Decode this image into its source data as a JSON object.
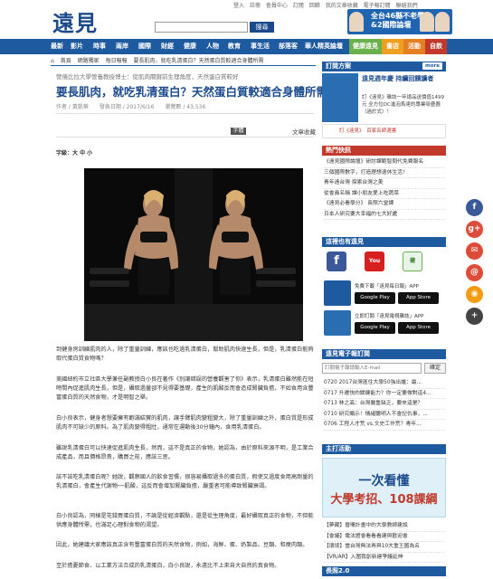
{
  "header": {
    "logo": "遠見",
    "top_links": [
      "登入",
      "註冊",
      "會員中心",
      "回首頁",
      "訂閱",
      "回饋",
      "回首頁",
      "我的文章收藏",
      "電子報訂閱",
      "回首頁",
      "聯絡我們"
    ],
    "search_button": "搜尋",
    "banner": {
      "line1": "全台46縣不老學",
      "line2": "&2國際論壇",
      "line3": "遠見"
    }
  },
  "nav": {
    "items": [
      "最新",
      "影片",
      "時事",
      "兩岸",
      "國際",
      "財經",
      "健康",
      "人物",
      "教育",
      "事生活",
      "部落客",
      "華人精英論壇"
    ],
    "special": [
      "健康遠見",
      "書店",
      "活動",
      "自飲"
    ]
  },
  "breadcrumb": [
    "首頁",
    "網路獨家",
    "每日報報",
    "要長肌肉，就吃乳清蛋白？天然蛋白質較適合身體所需"
  ],
  "article": {
    "subtitle": "營儀比拉大學營養教授博士：從肌肉關鍵前生理角度，天然蛋白質較好",
    "title": "要長肌肉，就吃乳清蛋白？天然蛋白質較適合身體所需",
    "meta": "作者 / 黃凱蒂　　發表日期 / 2017/6/16　　瀏覽數 / 43,536",
    "font_button": "字體",
    "collect": "文章收藏",
    "byline": "字級：大 中 小",
    "paragraphs": [
      "到健身房訓練肌肉的人，除了重量訓練，應該也吃過乳清蛋白，幫助肌肉快速生長，但是，乳清蛋白能夠取代蛋白質食物嗎？",
      "美國紐約市立社區大學兼任副教授白小良在著作《別讓錯誤的營養觀害了你》表示，乳清蛋白雖然能在短時間內促進肌肉生長，但是，攝取過量卻不見得要基礎，產生的肌酸反而會造成腎臟負擔，不如食用含豐富蛋白質的天然食物，才是明智之舉。",
      "白小良表示，健身者想要擁有飽滿結實的肌肉，讓手臂肌肉變粗變大，除了重量訓練之外，蛋白質是形成肌肉不可缺少的原料。為了肌肉變得粗壯，通常在運動後30分鐘內，食用乳清蛋白。",
      "雖說乳清蛋白可以快速促進肌肉生長，然而，這不是真正的食物，她認為，由於原料來源不明，是工業合成產品，而且價格昂貴，購買之前，應該三思。",
      "該不該吃乳清蛋白呢？她說，觀察國人的飲食習慣，很容易攝取過多的蛋白質，假使又過度食用高劑量的乳清蛋白，會產生代謝物──肌酸，這反而會增加腎臟負擔，嚴重者可能導致腎臟衰竭。",
      "白小良認為，同樣是花錢買蛋白質，不論是從經濟觀點，還是從生理角度，最好攝取真正的食物，不但能供應身體所需，也滿足心理對食物的渴望。",
      "因此，她建議大家應該真正含有豐富蛋白質的天然食物，例如，海鮮、蛋、奶製品、豆類、和瘦肉類。",
      "至於擔憂節食、以工業方法合成的乳清蛋白，白小良說，永遠比不上來自大自然的真食物。"
    ]
  },
  "sidebar": {
    "subscribe": {
      "header": "訂閱方案",
      "more": "more",
      "magazine_line1": "遠見週年慶 持續回饋讀者",
      "magazine_text": "訂《遠見》雜誌一年總品送價值1499元 全方位DC進泡馬達的專業吸塵器（過於式）！",
      "gift": "訂《遠見》　百家名師選書"
    },
    "featured": {
      "header": "熱門快訊",
      "items": [
        "《遠見國際論壇》研討課範智問代免費報名",
        "三個國際數字，打造理想退休生活！",
        "青年遠台灣 探索台灣之美",
        "從會員名稱 讓小朋友愛上吃蔬菜",
        "《遠見必看學分》 長照六堂課",
        "日本人研究要大幸福的七大好處"
      ]
    },
    "follow": {
      "header": "這裡也有遠見",
      "icons": [
        "facebook-icon",
        "youtube-icon",
        "health-icon"
      ],
      "app1": "免費下載「遠見每日報」APP",
      "app2": "立即訂閱「遠見電視雜誌」APP",
      "google_play": "Google Play",
      "app_store": "App Store"
    },
    "newsletter": {
      "header": "遠見電子報訂閱",
      "placeholder": "訂閱電子報請輸入E-mail",
      "confirm": "確定"
    },
    "latest": {
      "items": [
        "0720 2017台灣區住大學50強出爐：最...",
        "0717 升遷快的關鍵能力？你一定要做對這4...",
        "0713 林之高：台灣嚴重缺乏，要來這是？",
        "0710 研究顯示！情緒聽明人不會記仇事，...",
        "0706 工程人才荒 vs.文史工作荒？青年..."
      ]
    },
    "ad_header": "主打活動",
    "ad": {
      "line1": "一次看懂",
      "line2": "大學考招、108課綱"
    },
    "courses": [
      "【夢藏】晉嘴計畫中的大學教師建設",
      "【會議】電法證會看看看建與歡迎會",
      "【環境】當台灣無法再與10大重王國為名",
      "【VR/AR】入圍我創新建爭議延伸"
    ],
    "bottom_header": "長照2.0"
  }
}
